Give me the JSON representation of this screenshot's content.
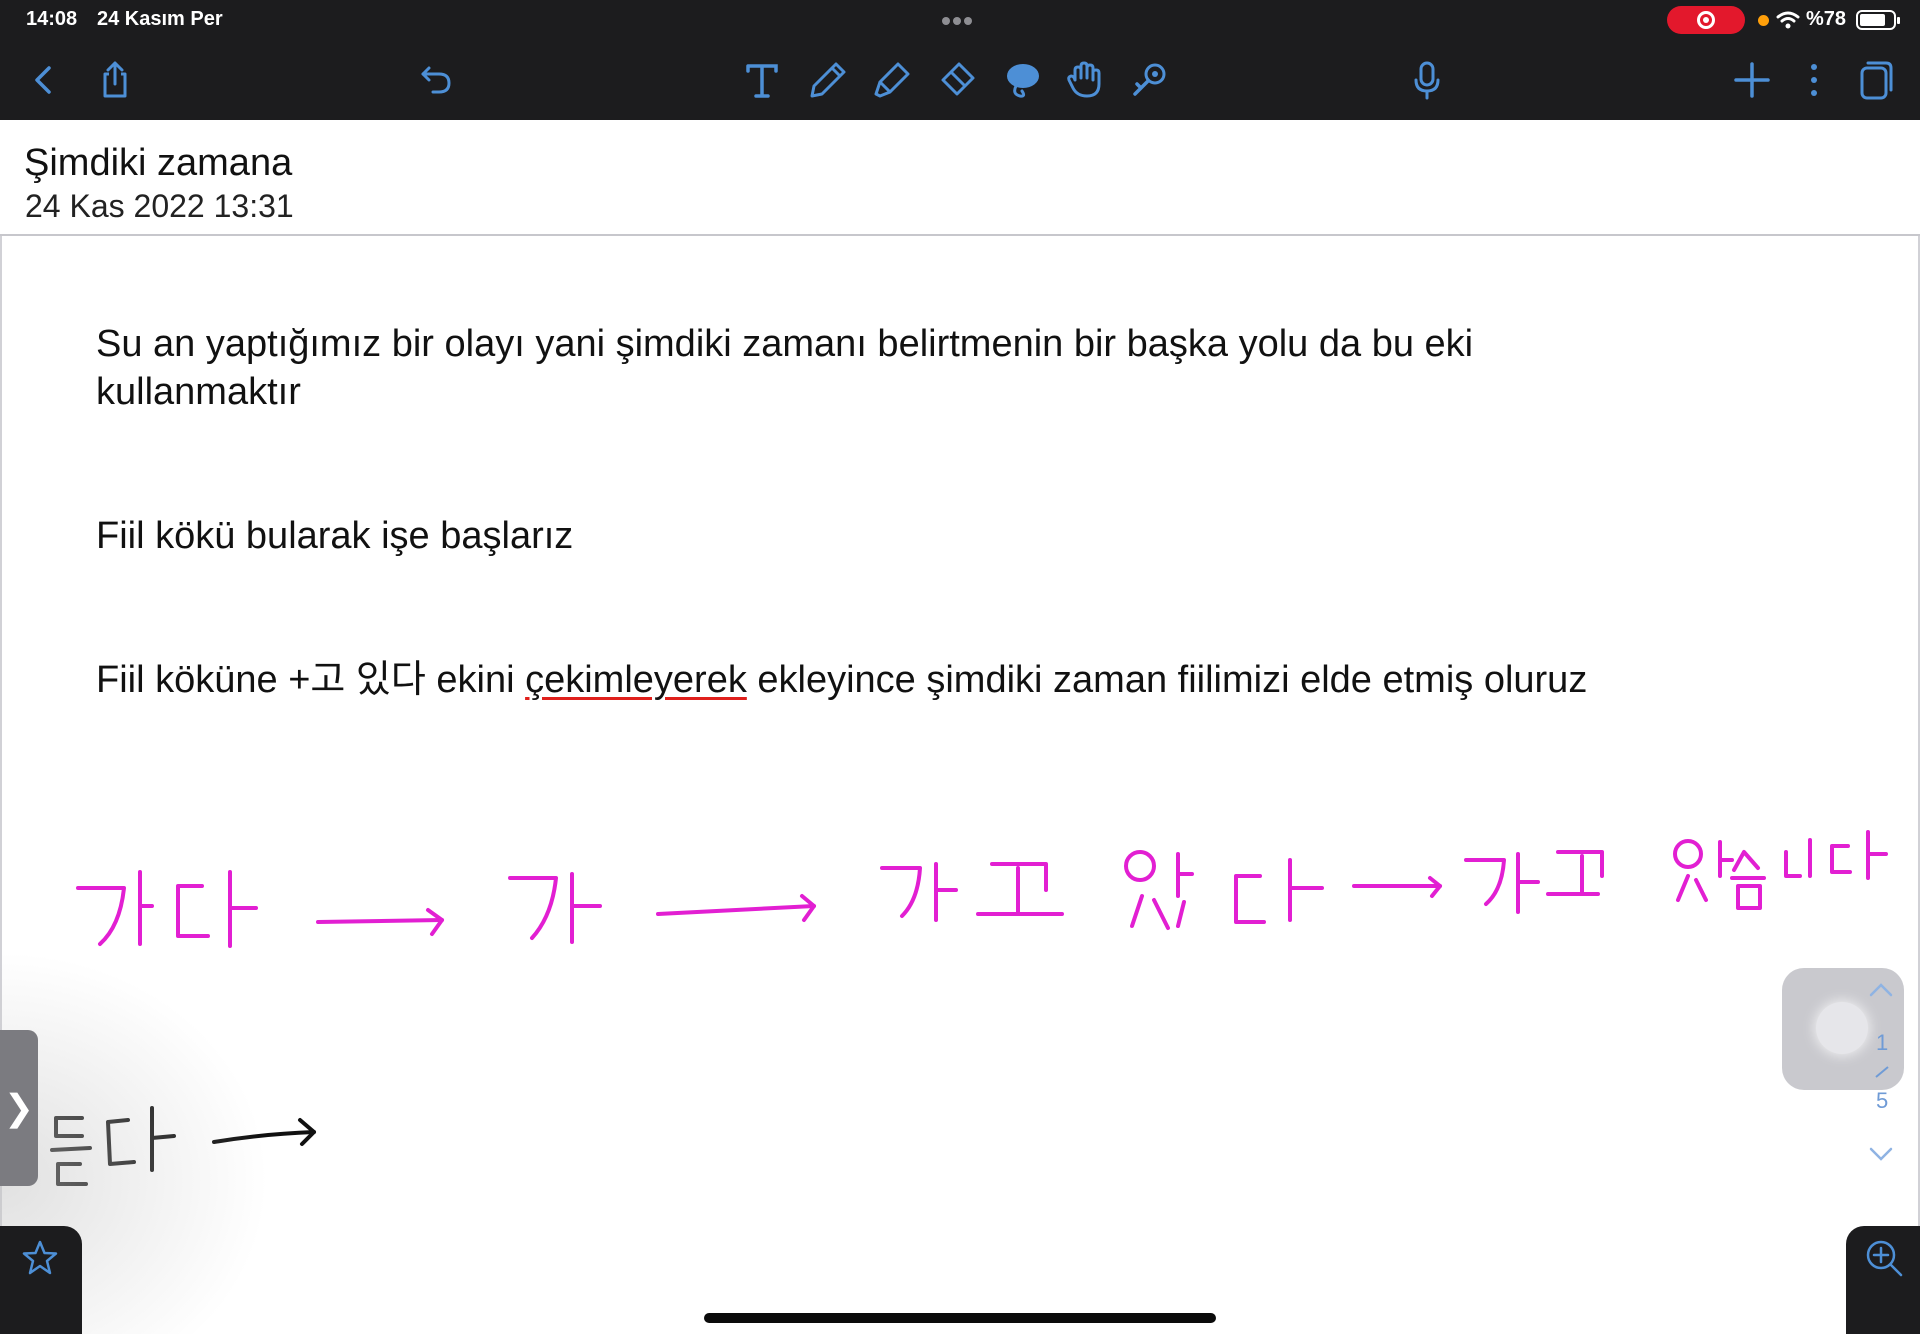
{
  "status_bar": {
    "time": "14:08",
    "date": "24 Kasım Per",
    "battery": "%78",
    "battery_level": 0.78,
    "recording_color": "#e3182c"
  },
  "toolbar": {
    "icons": [
      "back-icon",
      "share-icon",
      "undo-icon",
      "text-tool-icon",
      "pen-icon",
      "highlighter-icon",
      "eraser-icon",
      "lasso-icon",
      "hand-icon",
      "laser-pointer-icon",
      "microphone-icon",
      "add-icon",
      "more-icon",
      "pages-icon"
    ],
    "accent_color": "#4d8fd6"
  },
  "note": {
    "title": "Şimdiki zamana",
    "date": "24 Kas 2022 13:31"
  },
  "content": {
    "para1": "Su an yaptığımız bir olayı yani şimdiki zamanı belirtmenin bir başka yolu da bu eki kullanmaktır",
    "para2": "Fiil kökü bularak işe başlarız",
    "para3_before": "Fiil köküne +고 있다 ekini ",
    "para3_underlined": "çekimleyerek",
    "para3_after": " ekleyince şimdiki zaman fiilimizi elde etmiş oluruz"
  },
  "handwriting": {
    "line1": [
      "가다",
      "가",
      "가고 있다",
      "가고 있습니다"
    ],
    "line1_color": "#e21fd2",
    "line2": [
      "듣다"
    ],
    "line2_color": "#111111"
  },
  "pager": {
    "current": "1",
    "total": "5"
  },
  "side_tab": {
    "glyph": "❯"
  }
}
